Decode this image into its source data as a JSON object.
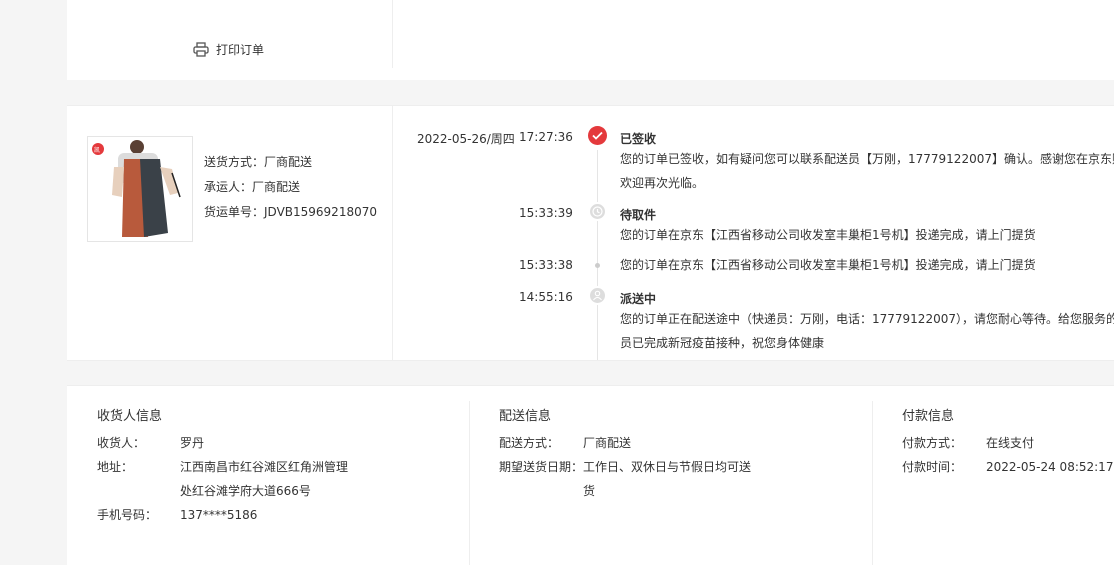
{
  "top": {
    "print_label": "打印订单"
  },
  "shipment": {
    "method": "送货方式：厂商配送",
    "carrier": "承运人：厂商配送",
    "tracking_no": "货运单号：JDVB15969218070",
    "product_image": "apron-product-image"
  },
  "timeline": [
    {
      "date": "2022-05-26/周四",
      "time": "17:27:36",
      "status": "已签收",
      "lines": [
        "您的订单已签收，如有疑问您可以联系配送员【万刚，17779122007】确认。感谢您在京东购物",
        "欢迎再次光临。"
      ],
      "icon": "check-icon"
    },
    {
      "date": "",
      "time": "15:33:39",
      "status": "待取件",
      "lines": [
        "您的订单在京东【江西省移动公司收发室丰巢柜1号机】投递完成，请上门提货"
      ],
      "icon": "clock-icon"
    },
    {
      "date": "",
      "time": "15:33:38",
      "status": "",
      "lines": [
        "您的订单在京东【江西省移动公司收发室丰巢柜1号机】投递完成，请上门提货"
      ],
      "icon": "dot-icon"
    },
    {
      "date": "",
      "time": "14:55:16",
      "status": "派送中",
      "lines": [
        "您的订单正在配送途中（快递员：万刚，电话：17779122007），请您耐心等待。给您服务的快",
        "员已完成新冠疫苗接种，祝您身体健康"
      ],
      "icon": "courier-icon"
    }
  ],
  "consignee": {
    "title": "收货人信息",
    "name_label": "收货人：",
    "name": "罗丹",
    "address_label": "地址：",
    "address_line1": "江西南昌市红谷滩区红角洲管理",
    "address_line2": "处红谷滩学府大道666号",
    "phone_label": "手机号码：",
    "phone": "137****5186"
  },
  "delivery": {
    "title": "配送信息",
    "method_label": "配送方式：",
    "method": "厂商配送",
    "date_label": "期望送货日期：",
    "date_line1": "工作日、双休日与节假日均可送",
    "date_line2": "货"
  },
  "payment": {
    "title": "付款信息",
    "method_label": "付款方式：",
    "method": "在线支付",
    "time_label": "付款时间：",
    "time": "2022-05-24 08:52:17"
  },
  "colors": {
    "accent": "#e4393c",
    "background": "#f5f5f5"
  }
}
